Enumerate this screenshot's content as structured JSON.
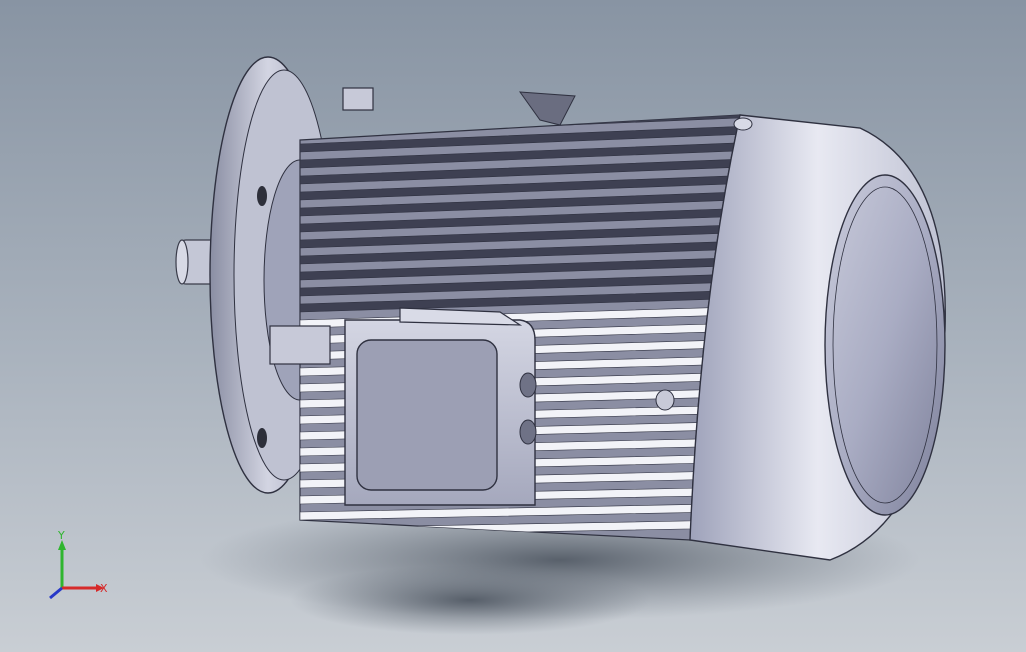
{
  "viewport": {
    "background_top": "#8894a3",
    "background_bottom": "#c9ced4"
  },
  "model": {
    "body_color": "#b6bac9",
    "fin_dark": "#3e4052",
    "fin_light": "#f2f3f8",
    "cap_color": "#8f92a8",
    "shadow_color": "#5c6470"
  },
  "triad": {
    "x_label": "X",
    "y_label": "Y",
    "x_color": "#d62a2a",
    "y_color": "#2fb52f",
    "z_color": "#2638c8"
  }
}
